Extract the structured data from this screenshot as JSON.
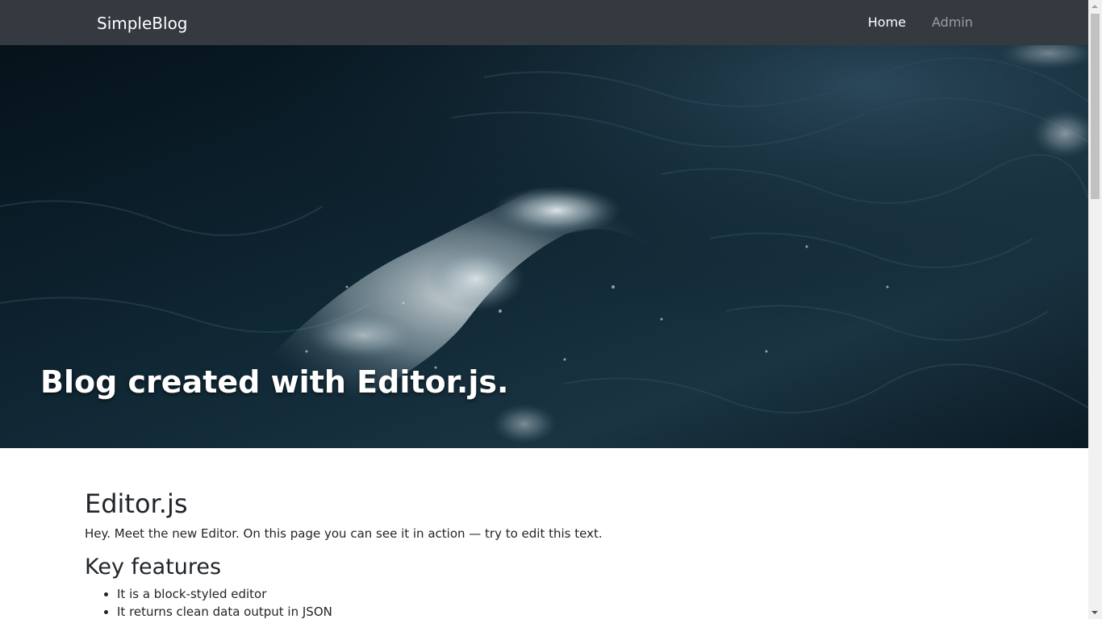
{
  "navbar": {
    "brand": "SimpleBlog",
    "links": [
      {
        "label": "Home"
      },
      {
        "label": "Admin"
      }
    ]
  },
  "hero": {
    "title": "Blog created with Editor.js."
  },
  "article": {
    "heading": "Editor.js",
    "intro": "Hey. Meet the new Editor. On this page you can see it in action — try to edit this text.",
    "subheading": "Key features",
    "features": [
      "It is a block-styled editor",
      "It returns clean data output in JSON"
    ]
  },
  "colors": {
    "navbar_bg": "#343a40",
    "hero_bg": "#0c1c26",
    "text": "#212529"
  }
}
